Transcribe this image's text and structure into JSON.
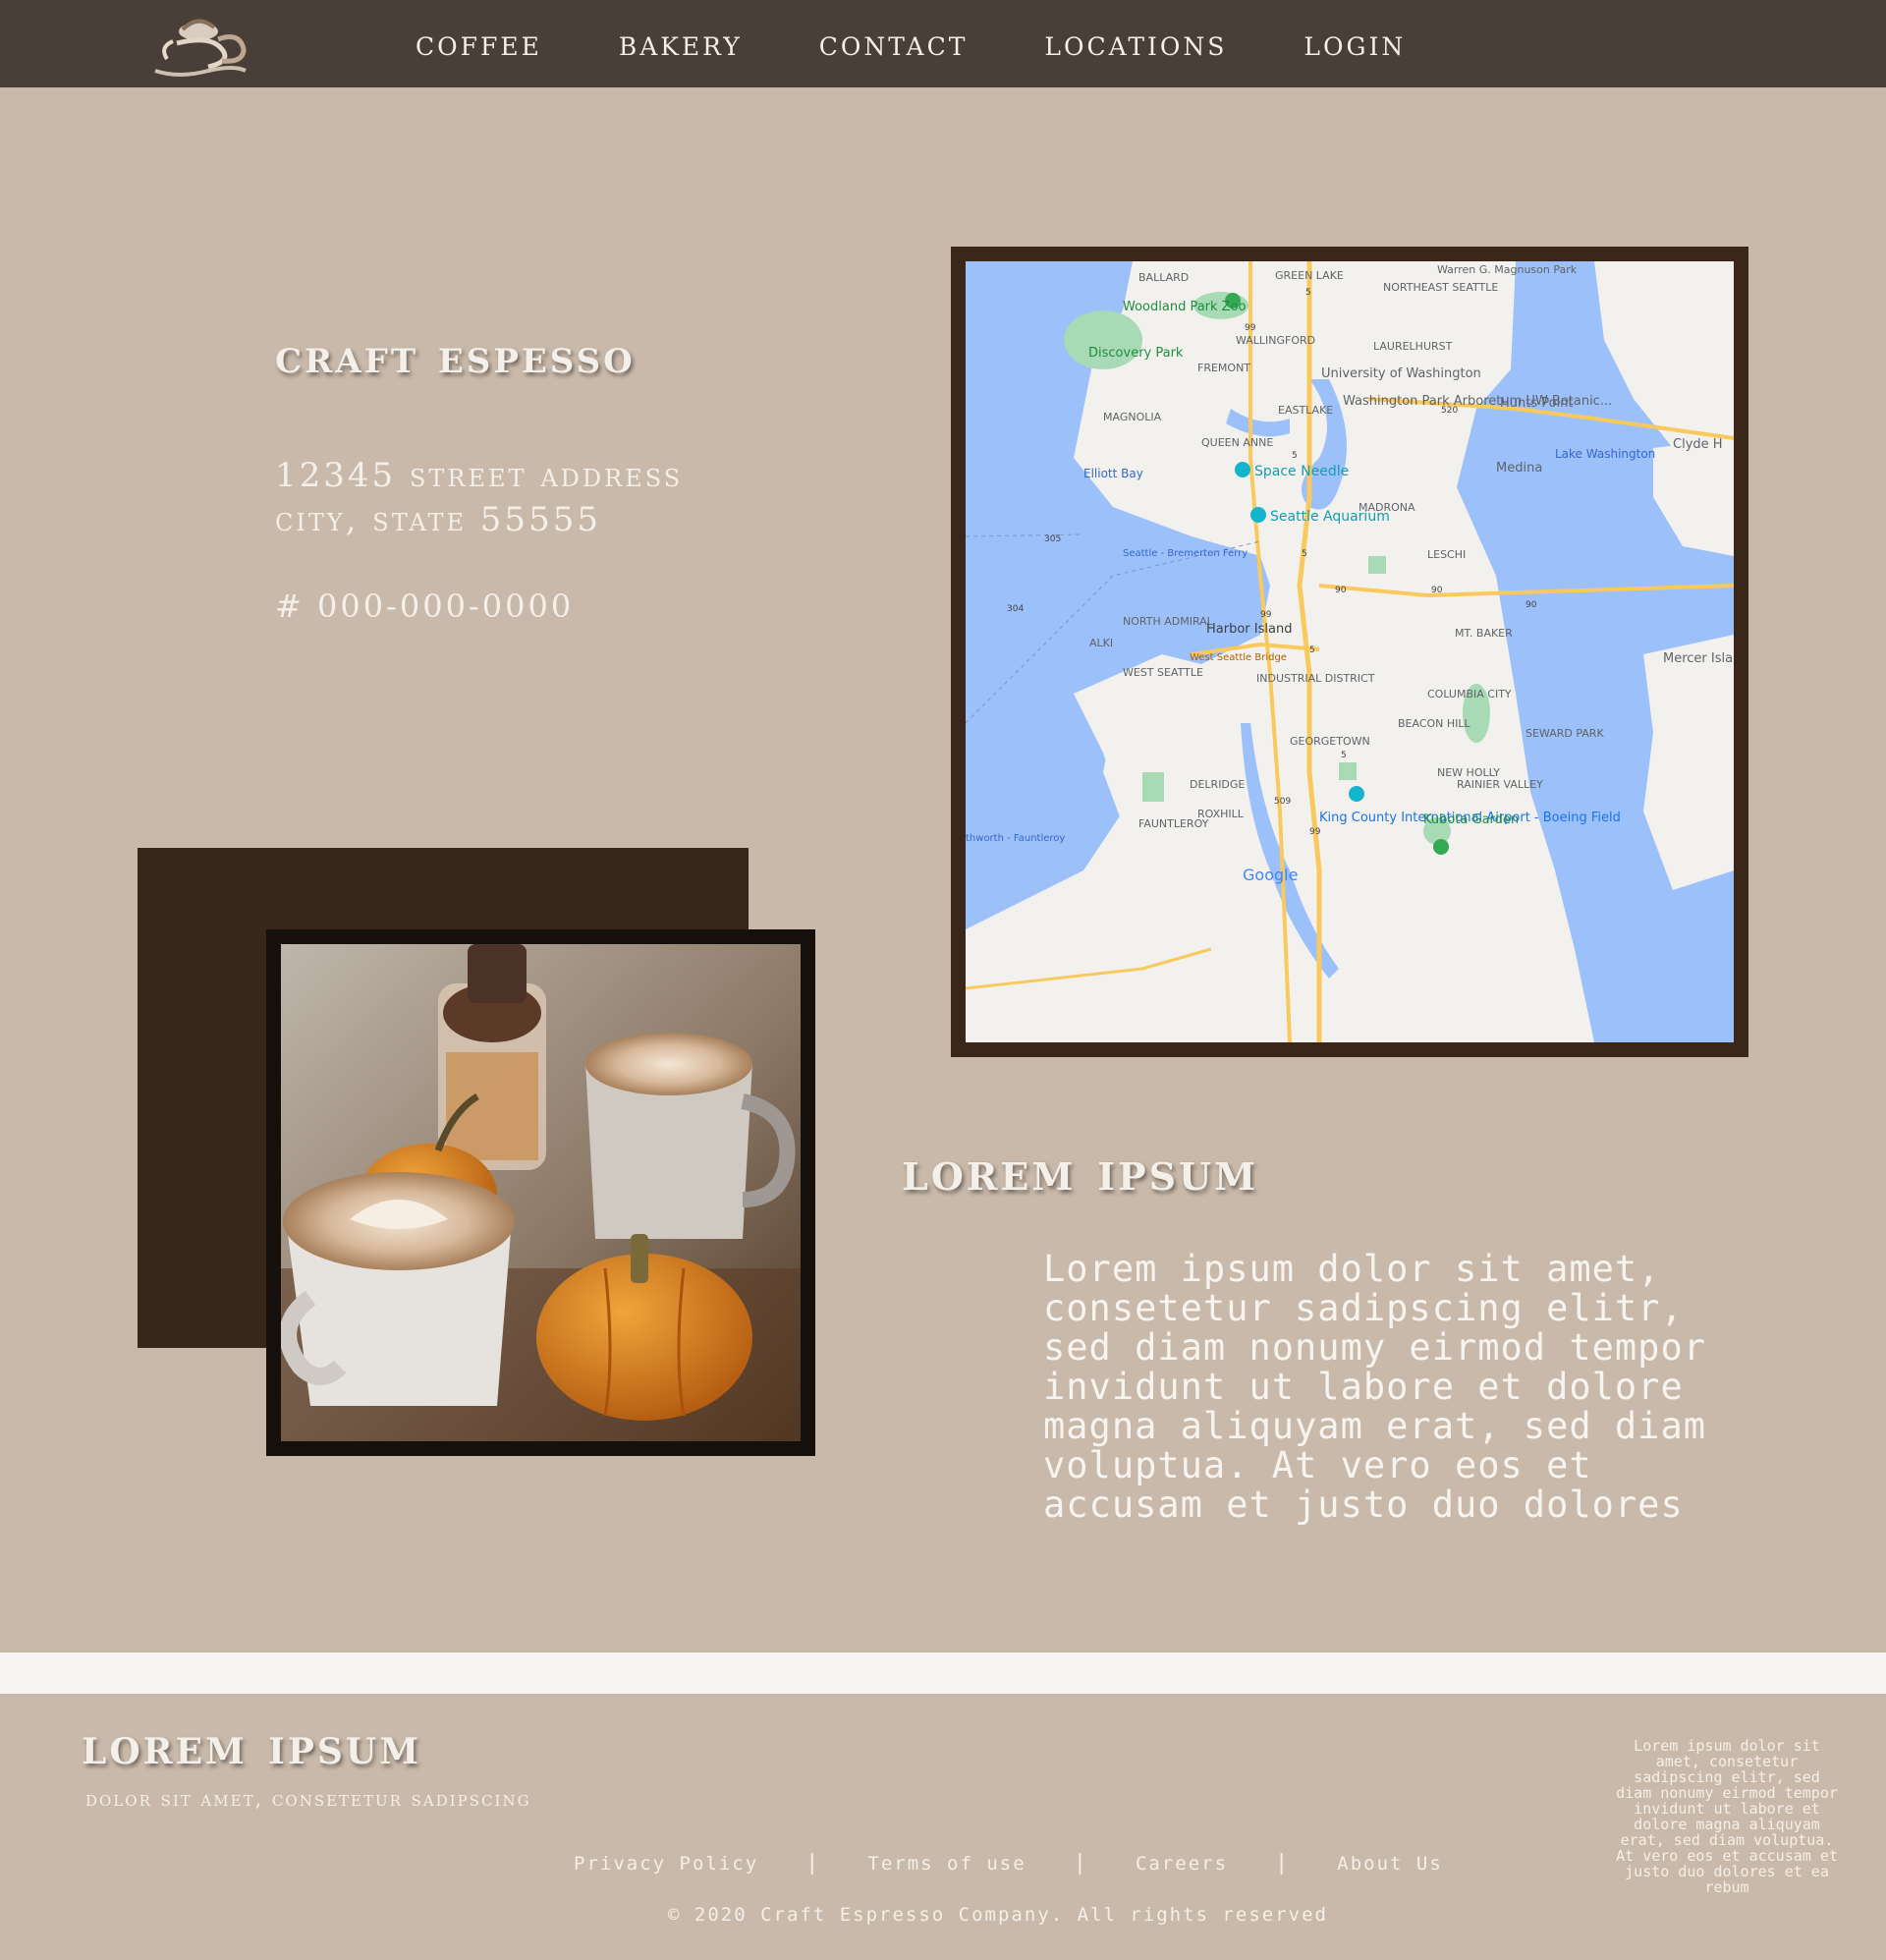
{
  "nav": {
    "logo_icon": "coffee-cup-logo-icon",
    "links": [
      {
        "label": "COFFEE"
      },
      {
        "label": "BAKERY"
      },
      {
        "label": "CONTACT"
      },
      {
        "label": "LOCATIONS"
      },
      {
        "label": "LOGIN"
      }
    ]
  },
  "contact": {
    "title": "CRAFT ESPESSO",
    "address_line1": "12345 STREET ADDRESS",
    "address_line2": "CITY, STATE 55555",
    "phone": "# 000-000-0000"
  },
  "map": {
    "labels": [
      "BALLARD",
      "GREEN LAKE",
      "NORTHEAST SEATTLE",
      "Warren G. Magnuson Park",
      "Woodland Park Zoo",
      "WALLINGFORD",
      "LAURELHURST",
      "Discovery Park",
      "FREMONT",
      "University of Washington",
      "Washington Park Arboretum UW Botanic...",
      "Hunts Point",
      "MAGNOLIA",
      "EASTLAKE",
      "Clyde H",
      "QUEEN ANNE",
      "Lake Washington",
      "Medina",
      "Elliott Bay",
      "Space Needle",
      "MADRONA",
      "Seattle Aquarium",
      "Seattle - Bremerton Ferry",
      "LESCHI",
      "NORTH ADMIRAL",
      "Harbor Island",
      "MT. BAKER",
      "ALKI",
      "West Seattle Bridge",
      "Mercer Islan",
      "WEST SEATTLE",
      "INDUSTRIAL DISTRICT",
      "COLUMBIA CITY",
      "BEACON HILL",
      "SEWARD PARK",
      "GEORGETOWN",
      "NEW HOLLY",
      "RAINIER VALLEY",
      "DELRIDGE",
      "ROXHILL",
      "King County International Airport - Boeing Field",
      "Kubota Garden",
      "FAUNTLEROY",
      "thworth - Fauntleroy",
      "Google"
    ],
    "highway_shields": [
      "5",
      "99",
      "520",
      "5",
      "305",
      "5",
      "90",
      "90",
      "90",
      "304",
      "99",
      "5",
      "509",
      "99",
      "5"
    ],
    "colors": {
      "water": "#9cc0f9",
      "land": "#f2f1ee",
      "park": "#a8dab5",
      "highway": "#f9c95d"
    }
  },
  "feature": {
    "title": "LOREM IPSUM",
    "body": "Lorem ipsum dolor sit amet, consetetur sadipscing elitr, sed diam nonumy eirmod tempor invidunt ut labore et dolore magna aliquyam erat, sed diam voluptua. At vero eos et accusam et justo duo dolores"
  },
  "footer": {
    "title": "LOREM IPSUM",
    "subtitle": "DOLOR SIT AMET, CONSETETUR SADIPSCING",
    "links": [
      {
        "label": "Privacy Policy"
      },
      {
        "label": "Terms of use"
      },
      {
        "label": "Careers"
      },
      {
        "label": "About Us"
      }
    ],
    "separator": "|",
    "copyright": "© 2020 Craft Espresso Company. All rights reserved",
    "blurb": "Lorem ipsum dolor sit amet, consetetur sadipscing elitr, sed diam nonumy eirmod tempor invidunt ut labore et dolore magna aliquyam erat, sed diam voluptua. At vero eos et accusam et justo duo dolores et ea rebum"
  },
  "colors": {
    "background": "#c9b9aa",
    "nav": "#4a3e39",
    "dark_block": "#37271a",
    "text_light": "#f4efe9"
  }
}
